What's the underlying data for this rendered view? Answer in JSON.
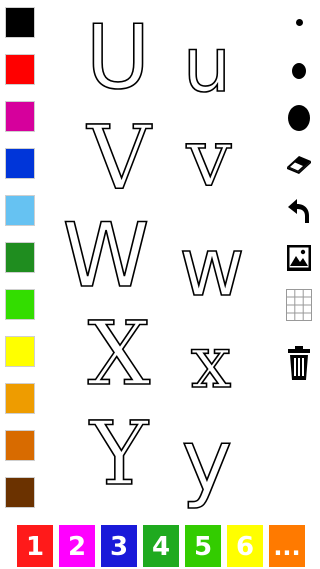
{
  "palette": {
    "colors": [
      "#000000",
      "#ff0000",
      "#d6009c",
      "#0035d9",
      "#66c2f2",
      "#1f8d1f",
      "#33dd00",
      "#ffff00",
      "#ee9c00",
      "#d86b00",
      "#6b3200"
    ]
  },
  "letters": {
    "uppercase": [
      "U",
      "V",
      "W",
      "X",
      "Y"
    ],
    "lowercase": [
      "u",
      "v",
      "w",
      "x",
      "y"
    ]
  },
  "tools": {
    "brush_sizes": [
      "small",
      "medium",
      "large"
    ],
    "eraser_icon": "eraser-icon",
    "undo_icon": "undo-icon",
    "image_icon": "image-icon",
    "grid_icon": "grid-icon",
    "trash_icon": "trash-icon"
  },
  "pages": {
    "buttons": [
      {
        "label": "1",
        "color": "#ff1a1a"
      },
      {
        "label": "2",
        "color": "#ff00ff"
      },
      {
        "label": "3",
        "color": "#1a1ad9"
      },
      {
        "label": "4",
        "color": "#1faa1f"
      },
      {
        "label": "5",
        "color": "#33cc00"
      },
      {
        "label": "6",
        "color": "#ffff00"
      },
      {
        "label": "...",
        "color": "#ff7a00"
      }
    ]
  }
}
